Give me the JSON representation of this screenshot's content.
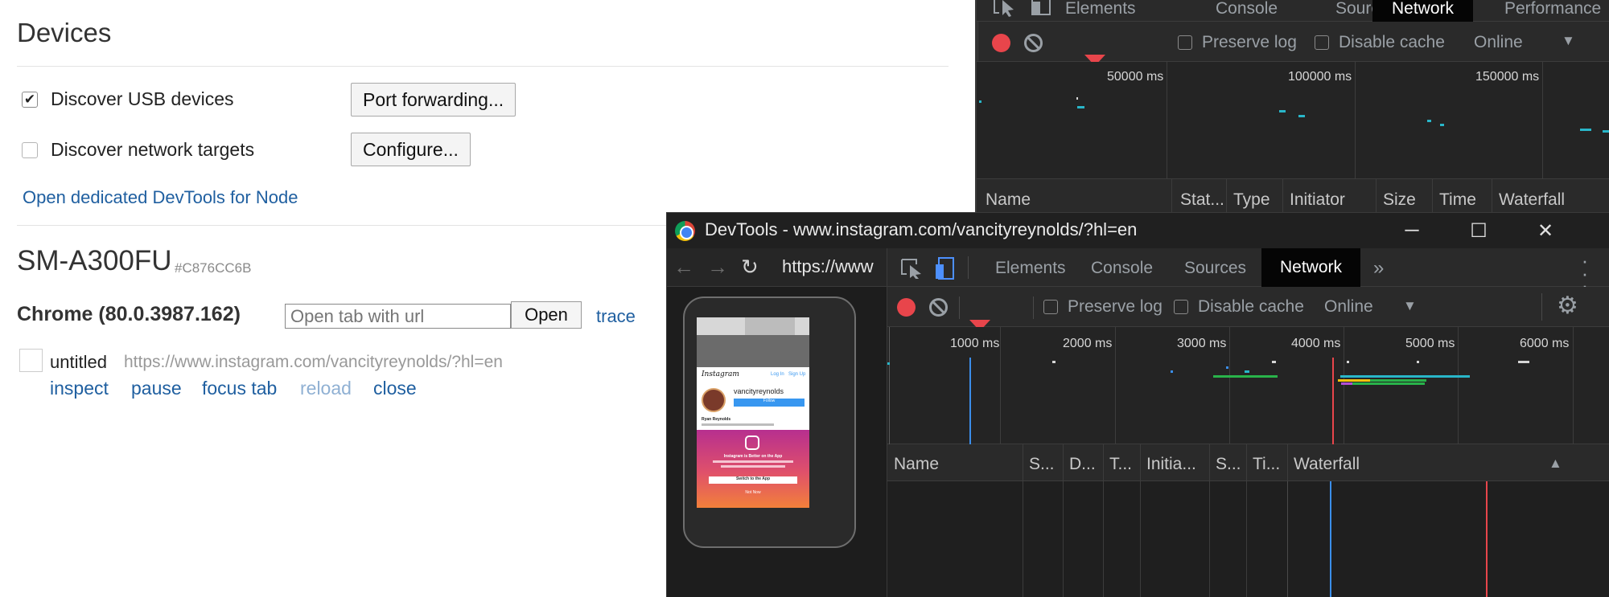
{
  "inspect": {
    "heading": "Devices",
    "usb_label": "Discover USB devices",
    "usb_checked": true,
    "port_forwarding_button": "Port forwarding...",
    "network_label": "Discover network targets",
    "network_checked": false,
    "configure_button": "Configure...",
    "node_link": "Open dedicated DevTools for Node",
    "device_name": "SM-A300FU",
    "device_serial": "#C876CC6B",
    "browser": "Chrome (80.0.3987.162)",
    "open_tab_placeholder": "Open tab with url",
    "open_button": "Open",
    "trace_link": "trace",
    "page_title": "untitled",
    "page_url": "https://www.instagram.com/vancityreynolds/?hl=en",
    "actions": [
      "inspect",
      "pause",
      "focus tab",
      "reload",
      "close"
    ]
  },
  "bg_devtools": {
    "tabs": [
      "Elements",
      "Console",
      "Sources",
      "Network",
      "Performance"
    ],
    "active_tab": "Network",
    "preserve_log": "Preserve log",
    "disable_cache": "Disable cache",
    "throttle": "Online",
    "ticks": [
      "50000 ms",
      "100000 ms",
      "150000 ms"
    ],
    "columns": [
      "Name",
      "Stat...",
      "Type",
      "Initiator",
      "Size",
      "Time",
      "Waterfall"
    ]
  },
  "window": {
    "title": "DevTools - www.instagram.com/vancityreynolds/?hl=en",
    "screencast_url": "https://www",
    "tabs": [
      "Elements",
      "Console",
      "Sources",
      "Network"
    ],
    "active_tab": "Network",
    "more_tabs": "»",
    "preserve_log": "Preserve log",
    "disable_cache": "Disable cache",
    "throttle": "Online",
    "ticks": [
      "1000 ms",
      "2000 ms",
      "3000 ms",
      "4000 ms",
      "5000 ms",
      "6000 ms"
    ],
    "columns": [
      "Name",
      "S...",
      "D...",
      "T...",
      "Initia...",
      "S...",
      "Ti...",
      "Waterfall"
    ]
  },
  "phone_page": {
    "logo": "Instagram",
    "login": "Log In",
    "signup": "Sign Up",
    "username": "vancityreynolds",
    "follow": "Follow",
    "full_name": "Ryan Reynolds",
    "promo_title": "Instagram is Better on the App",
    "promo_button": "Switch to the App",
    "promo_dismiss": "Not Now"
  },
  "colors": {
    "record": "#e8454b",
    "link": "#1f5fa0",
    "waterfall_green": "#29b34a",
    "waterfall_teal": "#29b6c9",
    "waterfall_blue": "#3b8eea",
    "waterfall_red": "#e8454b",
    "instagram_gradient_top": "#b72f8f",
    "instagram_gradient_bottom": "#f2803a"
  }
}
